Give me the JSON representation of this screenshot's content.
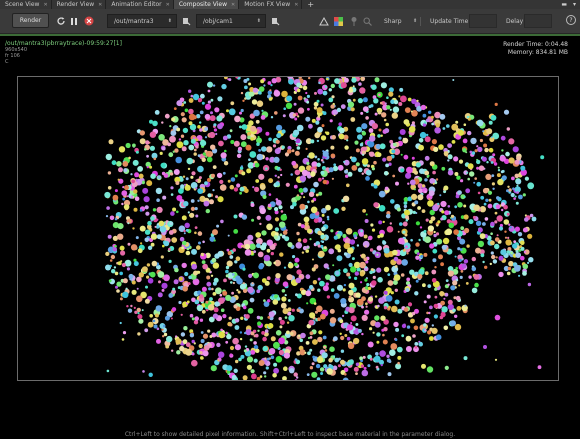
{
  "tabs": [
    {
      "label": "Scene View",
      "active": false
    },
    {
      "label": "Render View",
      "active": false
    },
    {
      "label": "Animation Editor",
      "active": false
    },
    {
      "label": "Composite View",
      "active": true
    },
    {
      "label": "Motion FX View",
      "active": false
    }
  ],
  "tab_add": "+",
  "toolbar": {
    "render_label": "Render",
    "rop_path": "/out/mantra3",
    "camera_path": "/obj/cam1",
    "sharp_label": "Sharp",
    "update_time_label": "Update Time",
    "delay_label": "Delay",
    "help_label": "?"
  },
  "overlay": {
    "node_info": "/out/mantra3(pbrraytrace)-09:59:27[1]",
    "resolution": "960x540",
    "frame": "fr 106",
    "channel": "C",
    "render_time": "Render Time: 0:04.48",
    "memory": "Memory:   834.81 MB"
  },
  "status_text": "Ctrl+Left to show detailed pixel information. Shift+Ctrl+Left to inspect base material in the parameter dialog.",
  "colors": {
    "accent_green": "#3c6b37",
    "path_green": "#7fd07f",
    "stop_red": "#d64545"
  }
}
